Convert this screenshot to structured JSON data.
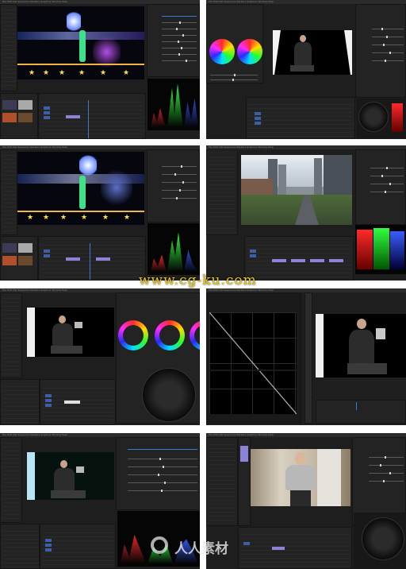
{
  "menu": "File  Edit  Clip  Sequence  Markers  Graphics  Window  Help",
  "watermark": "www.cg-ku.com",
  "logo_text": "人人素材",
  "colors": {
    "app_bg": "#1e1e1e",
    "panel": "#232323",
    "accent_blue": "#3a7bd5",
    "clip_violet": "#8c83d8",
    "watermark": "#e8c810"
  },
  "icons": [
    "star-icon",
    "color-wheel-icon",
    "vectorscope-icon",
    "playhead-icon"
  ],
  "tiles": [
    {
      "name": "tile-1"
    },
    {
      "name": "tile-2"
    },
    {
      "name": "tile-3"
    },
    {
      "name": "tile-4"
    },
    {
      "name": "tile-5"
    },
    {
      "name": "tile-6"
    },
    {
      "name": "tile-7"
    },
    {
      "name": "tile-8"
    }
  ]
}
